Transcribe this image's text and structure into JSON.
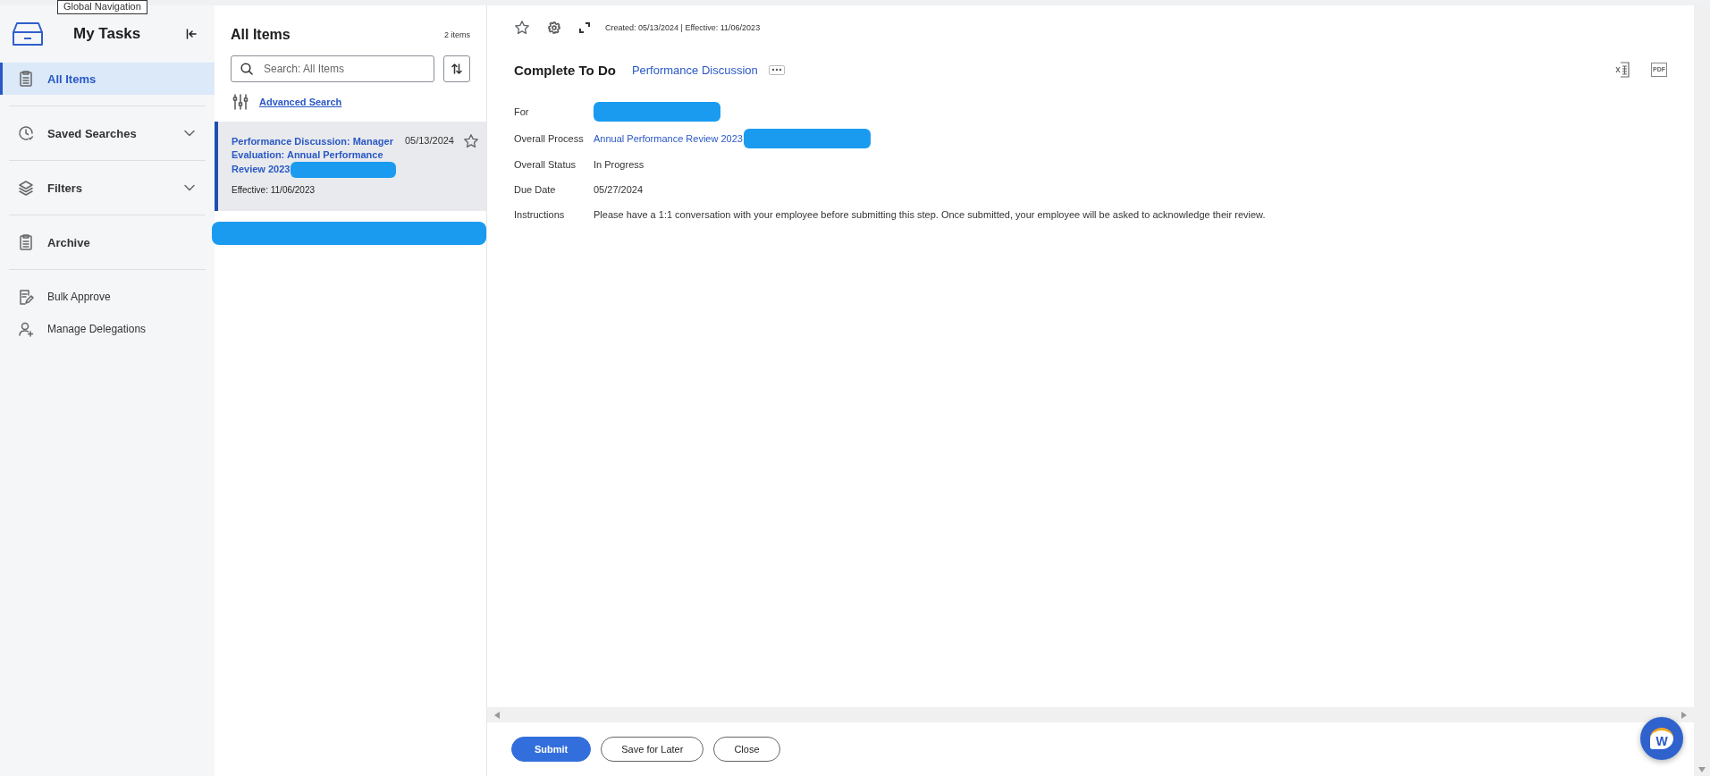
{
  "tooltip": {
    "text": "Global Navigation"
  },
  "sidebar": {
    "title": "My Tasks",
    "items": [
      {
        "label": "All Items",
        "kind": "nav",
        "selected": true
      },
      {
        "label": "Saved Searches",
        "kind": "expandable",
        "selected": false,
        "expanded": false
      },
      {
        "label": "Filters",
        "kind": "expandable",
        "selected": false,
        "expanded": false
      },
      {
        "label": "Archive",
        "kind": "nav",
        "selected": false
      }
    ],
    "links": [
      {
        "label": "Bulk Approve"
      },
      {
        "label": "Manage Delegations"
      }
    ]
  },
  "inbox": {
    "title": "All Items",
    "count": "2 items",
    "search": {
      "placeholder": "Search: All Items"
    },
    "advanced_search": "Advanced Search",
    "items": [
      {
        "kind": "task",
        "title": "Performance Discussion: Manager Evaluation: Annual Performance Review 2023",
        "redacted": true,
        "date": "05/13/2024",
        "effective": "Effective: 11/06/2023",
        "selected": true,
        "starred": false
      },
      {
        "kind": "redacted"
      }
    ]
  },
  "detail": {
    "meta": "Created: 05/13/2024 | Effective: 11/06/2023",
    "starred": false,
    "title": "Complete To Do",
    "subtitle": "Performance Discussion",
    "exports": [
      {
        "kind": "excel"
      },
      {
        "kind": "pdf",
        "label": "PDF"
      }
    ],
    "fields": [
      {
        "label": "For",
        "redacted": true
      },
      {
        "label": "Overall Process",
        "value": "Annual Performance Review 2023",
        "link": true,
        "redacted": true
      },
      {
        "label": "Overall Status",
        "value": "In Progress"
      },
      {
        "label": "Due Date",
        "value": "05/27/2024"
      },
      {
        "label": "Instructions",
        "value": "Please have a 1:1 conversation with your employee before submitting this step. Once submitted, your employee will be asked to acknowledge their review."
      }
    ],
    "buttons": [
      {
        "label": "Submit",
        "primary": true
      },
      {
        "label": "Save for Later",
        "primary": false
      },
      {
        "label": "Close",
        "primary": false
      }
    ]
  },
  "chat": {
    "label": "W"
  }
}
